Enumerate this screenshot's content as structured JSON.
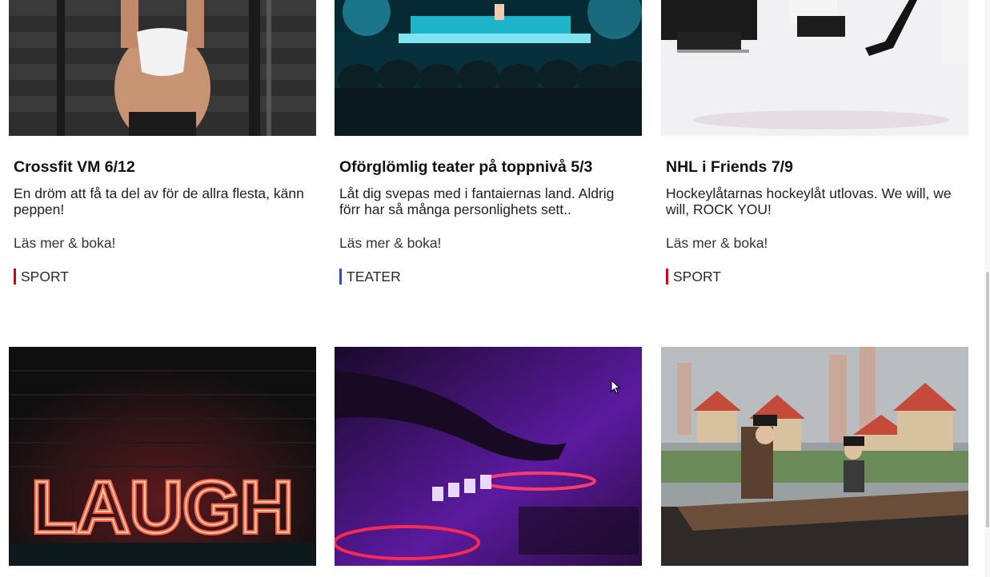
{
  "events": [
    {
      "title": "Crossfit VM 6/12",
      "description": "En dröm att få ta del av för de allra flesta, känn peppen!",
      "link_label": "Läs mer & boka!",
      "category": "SPORT",
      "image": "crossfit athlete back view"
    },
    {
      "title": "Oförglömlig teater på toppnivå 5/3",
      "description": "Låt dig svepas med i fantaiernas land. Aldrig förr har så många personlighets sett..",
      "link_label": "Läs mer & boka!",
      "category": "TEATER",
      "image": "theatre audience facing stage"
    },
    {
      "title": "NHL i Friends 7/9",
      "description": "Hockeylåtarnas hockeylåt utlovas. We will, we will, ROCK YOU!",
      "link_label": "Läs mer & boka!",
      "category": "SPORT",
      "image": "hockey skates on ice"
    }
  ],
  "second_row": [
    {
      "image": "neon laugh sign on brick wall",
      "neon_text": "LAUGH"
    },
    {
      "image": "dj hand on mixer in purple light"
    },
    {
      "image": "puppet theatre town scene"
    }
  ],
  "colors": {
    "sport_accent": "#d0021b",
    "teater_accent": "#3a4bb0"
  }
}
